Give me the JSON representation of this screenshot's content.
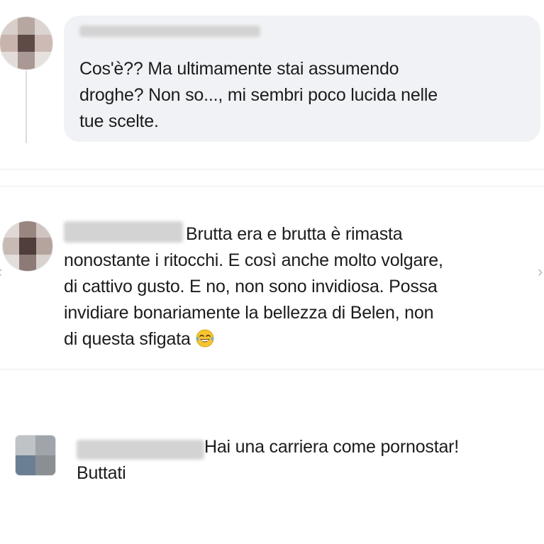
{
  "comments": [
    {
      "lines": [
        "Cos'è?? Ma ultimamente stai assumendo",
        "droghe? Non so..., mi sembri poco lucida nelle",
        "tue scelte."
      ]
    },
    {
      "lines": [
        "Brutta era e brutta è rimasta",
        "nonostante i ritocchi. E così anche molto volgare,",
        "di cattivo gusto. E no, non sono invidiosa. Possa",
        "invidiare bonariamente la bellezza di Belen, non",
        "di questa sfigata"
      ],
      "emoji": "face-with-tears-of-joy-emoji"
    },
    {
      "lines": [
        "Hai una carriera come pornostar!",
        "Buttati"
      ]
    }
  ],
  "colors": {
    "bubble": "#f0f2f5",
    "text": "#1c1c1c",
    "separator": "#ececec"
  }
}
